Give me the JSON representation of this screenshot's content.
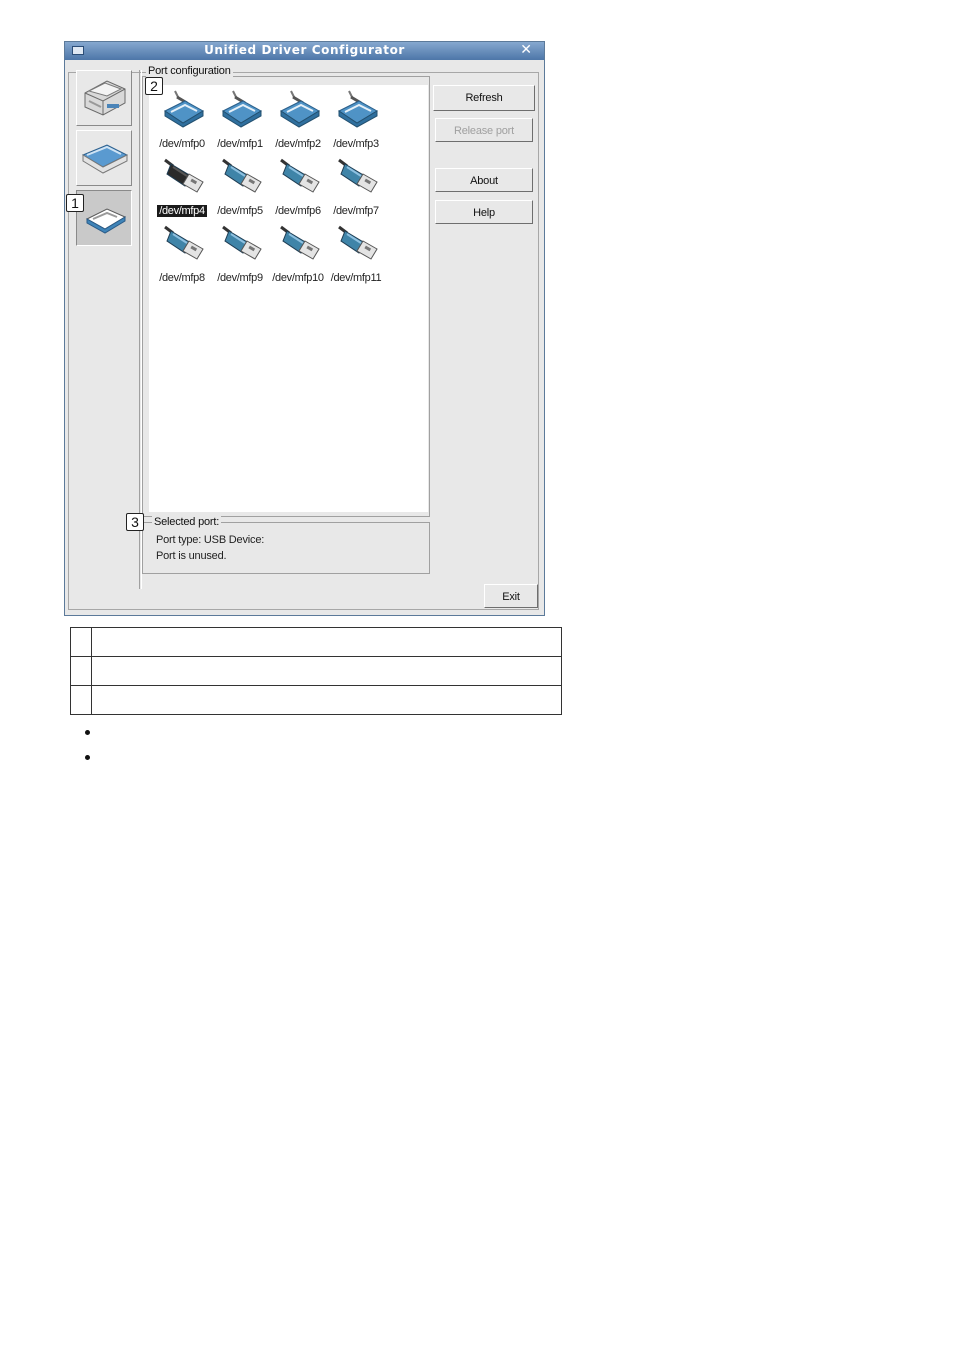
{
  "window": {
    "title": "Unified Driver Configurator",
    "close_glyph": "✕"
  },
  "sidebar": {
    "items": [
      {
        "name": "printer-configuration",
        "icon": "printer-icon"
      },
      {
        "name": "scanner-configuration",
        "icon": "scanner-icon"
      },
      {
        "name": "port-configuration",
        "icon": "port-icon",
        "selected": true
      }
    ]
  },
  "port_config": {
    "label": "Port configuration",
    "ports": [
      {
        "label": "/dev/mfp0",
        "type": "parallel"
      },
      {
        "label": "/dev/mfp1",
        "type": "parallel"
      },
      {
        "label": "/dev/mfp2",
        "type": "parallel"
      },
      {
        "label": "/dev/mfp3",
        "type": "parallel"
      },
      {
        "label": "/dev/mfp4",
        "type": "usb",
        "selected": true
      },
      {
        "label": "/dev/mfp5",
        "type": "usb"
      },
      {
        "label": "/dev/mfp6",
        "type": "usb"
      },
      {
        "label": "/dev/mfp7",
        "type": "usb"
      },
      {
        "label": "/dev/mfp8",
        "type": "usb"
      },
      {
        "label": "/dev/mfp9",
        "type": "usb"
      },
      {
        "label": "/dev/mfp10",
        "type": "usb"
      },
      {
        "label": "/dev/mfp11",
        "type": "usb"
      }
    ]
  },
  "buttons": {
    "refresh": "Refresh",
    "release_port": "Release port",
    "about": "About",
    "help": "Help",
    "exit": "Exit"
  },
  "selected_port": {
    "label": "Selected port:",
    "line1": "Port type: USB   Device:",
    "line2": "Port is unused."
  },
  "callouts": [
    "1",
    "2",
    "3"
  ],
  "colors": {
    "title_bar": "#4d76a8",
    "parallel_port": "#4f93c6",
    "usb_port": "#3f84a8",
    "selected_port": "#2a2a2a"
  }
}
